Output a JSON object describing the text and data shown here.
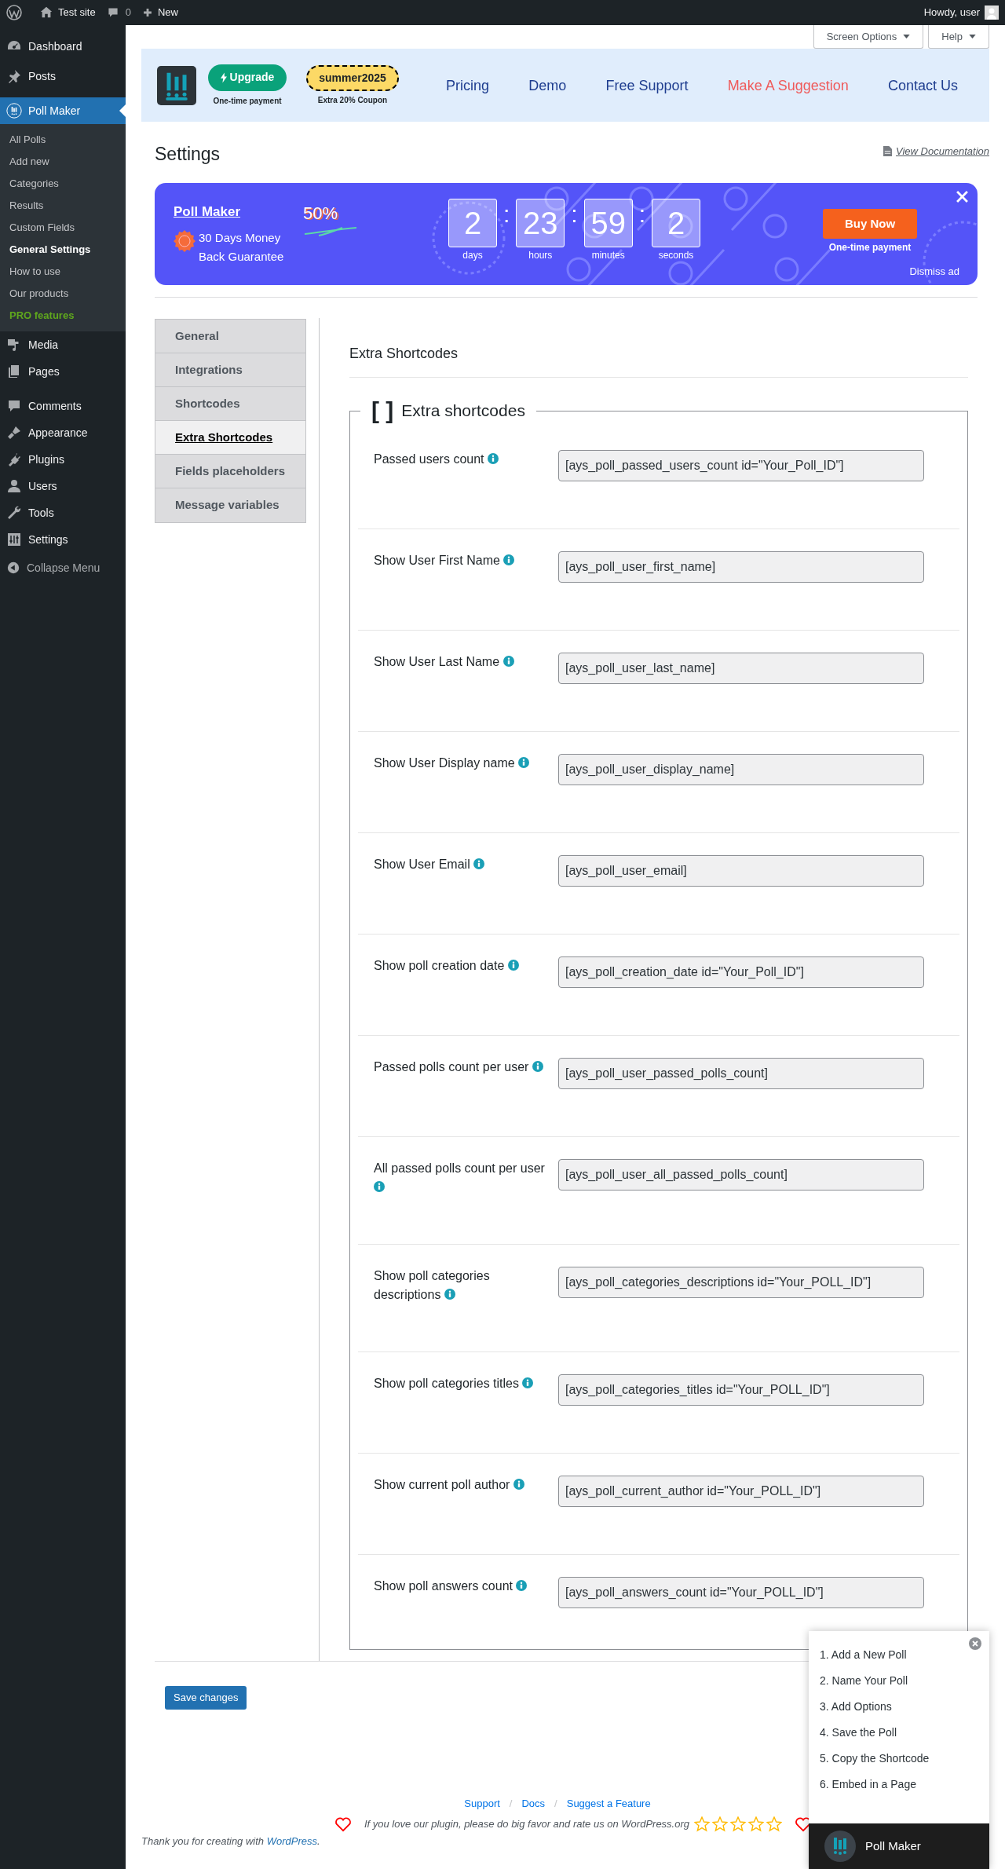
{
  "admin_bar": {
    "site": "Test site",
    "comments": "0",
    "new": "New",
    "greeting": "Howdy, user"
  },
  "sidebar": {
    "items": [
      {
        "label": "Dashboard",
        "selected": false
      },
      {
        "label": "Posts",
        "selected": false
      },
      {
        "label": "Poll Maker",
        "selected": true,
        "children": [
          {
            "label": "All Polls",
            "selected": false,
            "kind": "link"
          },
          {
            "label": "Add new",
            "selected": false,
            "kind": "link"
          },
          {
            "label": "Categories",
            "selected": false,
            "kind": "link"
          },
          {
            "label": "Results",
            "selected": false,
            "kind": "link"
          },
          {
            "label": "Custom Fields",
            "selected": false,
            "kind": "link"
          },
          {
            "label": "General Settings",
            "selected": true,
            "kind": "link"
          },
          {
            "label": "How to use",
            "selected": false,
            "kind": "link"
          },
          {
            "label": "Our products",
            "selected": false,
            "kind": "link"
          },
          {
            "label": "PRO features",
            "selected": false,
            "kind": "pro"
          }
        ]
      },
      {
        "label": "Media",
        "selected": false
      },
      {
        "label": "Pages",
        "selected": false
      },
      {
        "label": "Comments",
        "selected": false
      },
      {
        "label": "Appearance",
        "selected": false
      },
      {
        "label": "Plugins",
        "selected": false
      },
      {
        "label": "Users",
        "selected": false
      },
      {
        "label": "Tools",
        "selected": false
      },
      {
        "label": "Settings",
        "selected": false
      }
    ],
    "collapse": "Collapse Menu"
  },
  "screen_buttons": [
    "Screen Options",
    "Help"
  ],
  "plugin_header": {
    "upgrade": {
      "label": "Upgrade",
      "note": "One-time payment"
    },
    "coupon": {
      "code": "summer2025",
      "note": "Extra 20% Coupon"
    },
    "nav": [
      {
        "label": "Pricing",
        "kind": "link"
      },
      {
        "label": "Demo",
        "kind": "link"
      },
      {
        "label": "Free Support",
        "kind": "link"
      },
      {
        "label": "Make A Suggestion",
        "kind": "accent"
      },
      {
        "label": "Contact Us",
        "kind": "link"
      }
    ]
  },
  "page_title": "Settings",
  "doc_link": "View Documentation",
  "promo": {
    "title": "Poll Maker",
    "guarantee": "30 Days Money Back Guarantee",
    "discount": "50%",
    "countdown": [
      {
        "value": "2",
        "unit": "days"
      },
      {
        "value": "23",
        "unit": "hours"
      },
      {
        "value": "59",
        "unit": "minutes"
      },
      {
        "value": "2",
        "unit": "seconds"
      }
    ],
    "separator": ":",
    "button": "Buy Now",
    "note": "One-time payment",
    "dismiss": "Dismiss ad"
  },
  "tabs": [
    {
      "label": "General",
      "selected": false
    },
    {
      "label": "Integrations",
      "selected": false
    },
    {
      "label": "Shortcodes",
      "selected": false
    },
    {
      "label": "Extra Shortcodes",
      "selected": true
    },
    {
      "label": "Fields placeholders",
      "selected": false
    },
    {
      "label": "Message variables",
      "selected": false
    }
  ],
  "section_title": "Extra Shortcodes",
  "fieldset": {
    "mark": "[ ]",
    "legend": "Extra shortcodes",
    "rows": [
      {
        "label": "Passed users count",
        "value": "[ays_poll_passed_users_count id=\"Your_Poll_ID\"]"
      },
      {
        "label": "Show User First Name",
        "value": "[ays_poll_user_first_name]"
      },
      {
        "label": "Show User Last Name",
        "value": "[ays_poll_user_last_name]"
      },
      {
        "label": "Show User Display name",
        "value": "[ays_poll_user_display_name]"
      },
      {
        "label": "Show User Email",
        "value": "[ays_poll_user_email]"
      },
      {
        "label": "Show poll creation date",
        "value": "[ays_poll_creation_date id=\"Your_Poll_ID\"]"
      },
      {
        "label": "Passed polls count per user",
        "value": "[ays_poll_user_passed_polls_count]"
      },
      {
        "label": "All passed polls count per user",
        "value": "[ays_poll_user_all_passed_polls_count]"
      },
      {
        "label": "Show poll categories descriptions",
        "value": "[ays_poll_categories_descriptions id=\"Your_POLL_ID\"]"
      },
      {
        "label": "Show poll categories titles",
        "value": "[ays_poll_categories_titles id=\"Your_POLL_ID\"]"
      },
      {
        "label": "Show current poll author",
        "value": "[ays_poll_current_author id=\"Your_POLL_ID\"]"
      },
      {
        "label": "Show poll answers count",
        "value": "[ays_poll_answers_count id=\"Your_POLL_ID\"]"
      }
    ]
  },
  "save_button": "Save changes",
  "footer": {
    "links": [
      "Support",
      "Docs",
      "Suggest a Feature"
    ],
    "separator": "/",
    "rate_text": "If you love our plugin, please do big favor and rate us on WordPress.org",
    "stars": 0,
    "thanks": {
      "text": "Thank you for creating with",
      "link": "WordPress",
      "suffix": "."
    }
  },
  "guide": {
    "steps": [
      "1. Add a New Poll",
      "2. Name Your Poll",
      "3. Add Options",
      "4. Save the Poll",
      "5. Copy the Shortcode",
      "6. Embed in a Page"
    ],
    "title": "Poll Maker"
  }
}
